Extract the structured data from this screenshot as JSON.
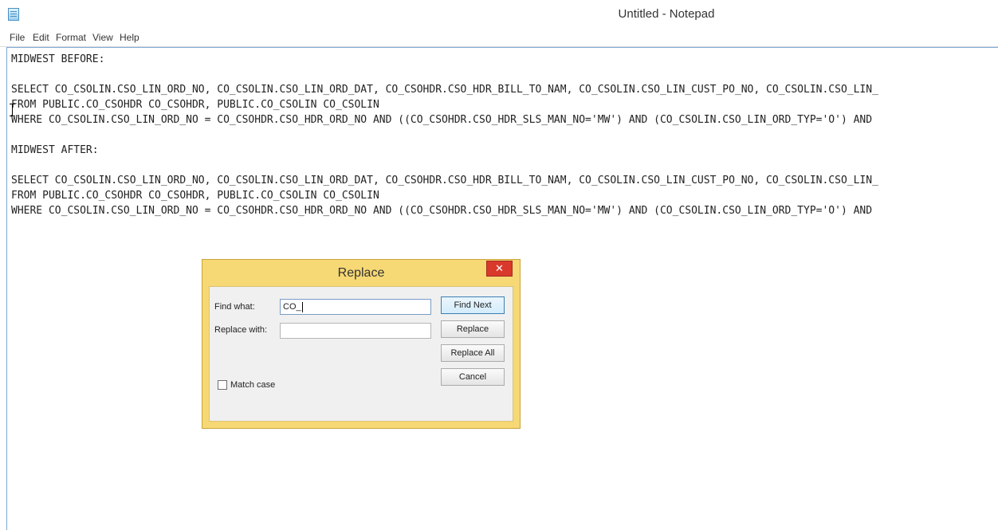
{
  "window": {
    "title": "Untitled - Notepad",
    "icon": "notepad-icon"
  },
  "menu": [
    "File",
    "Edit",
    "Format",
    "View",
    "Help"
  ],
  "editor": {
    "lines": [
      "MIDWEST BEFORE:",
      "",
      "SELECT CO_CSOLIN.CSO_LIN_ORD_NO, CO_CSOLIN.CSO_LIN_ORD_DAT, CO_CSOHDR.CSO_HDR_BILL_TO_NAM, CO_CSOLIN.CSO_LIN_CUST_PO_NO, CO_CSOLIN.CSO_LIN_",
      "FROM PUBLIC.CO_CSOHDR CO_CSOHDR, PUBLIC.CO_CSOLIN CO_CSOLIN",
      "WHERE CO_CSOLIN.CSO_LIN_ORD_NO = CO_CSOHDR.CSO_HDR_ORD_NO AND ((CO_CSOHDR.CSO_HDR_SLS_MAN_NO='MW') AND (CO_CSOLIN.CSO_LIN_ORD_TYP='O') AND",
      "",
      "MIDWEST AFTER:",
      "",
      "SELECT CO_CSOLIN.CSO_LIN_ORD_NO, CO_CSOLIN.CSO_LIN_ORD_DAT, CO_CSOHDR.CSO_HDR_BILL_TO_NAM, CO_CSOLIN.CSO_LIN_CUST_PO_NO, CO_CSOLIN.CSO_LIN_",
      "FROM PUBLIC.CO_CSOHDR CO_CSOHDR, PUBLIC.CO_CSOLIN CO_CSOLIN",
      "WHERE CO_CSOLIN.CSO_LIN_ORD_NO = CO_CSOHDR.CSO_HDR_ORD_NO AND ((CO_CSOHDR.CSO_HDR_SLS_MAN_NO='MW') AND (CO_CSOLIN.CSO_LIN_ORD_TYP='O') AND"
    ]
  },
  "replace_dialog": {
    "title": "Replace",
    "close_glyph": "✕",
    "find_label": "Find what:",
    "find_value": "CO_",
    "replace_label": "Replace with:",
    "replace_value": "",
    "buttons": {
      "find_next": "Find Next",
      "replace": "Replace",
      "replace_all": "Replace All",
      "cancel": "Cancel"
    },
    "match_case_label": "Match case",
    "match_case_checked": false
  },
  "colors": {
    "dialog_frame": "#f6d874",
    "close_button": "#d8392b",
    "editor_border": "#7fa7d6"
  }
}
